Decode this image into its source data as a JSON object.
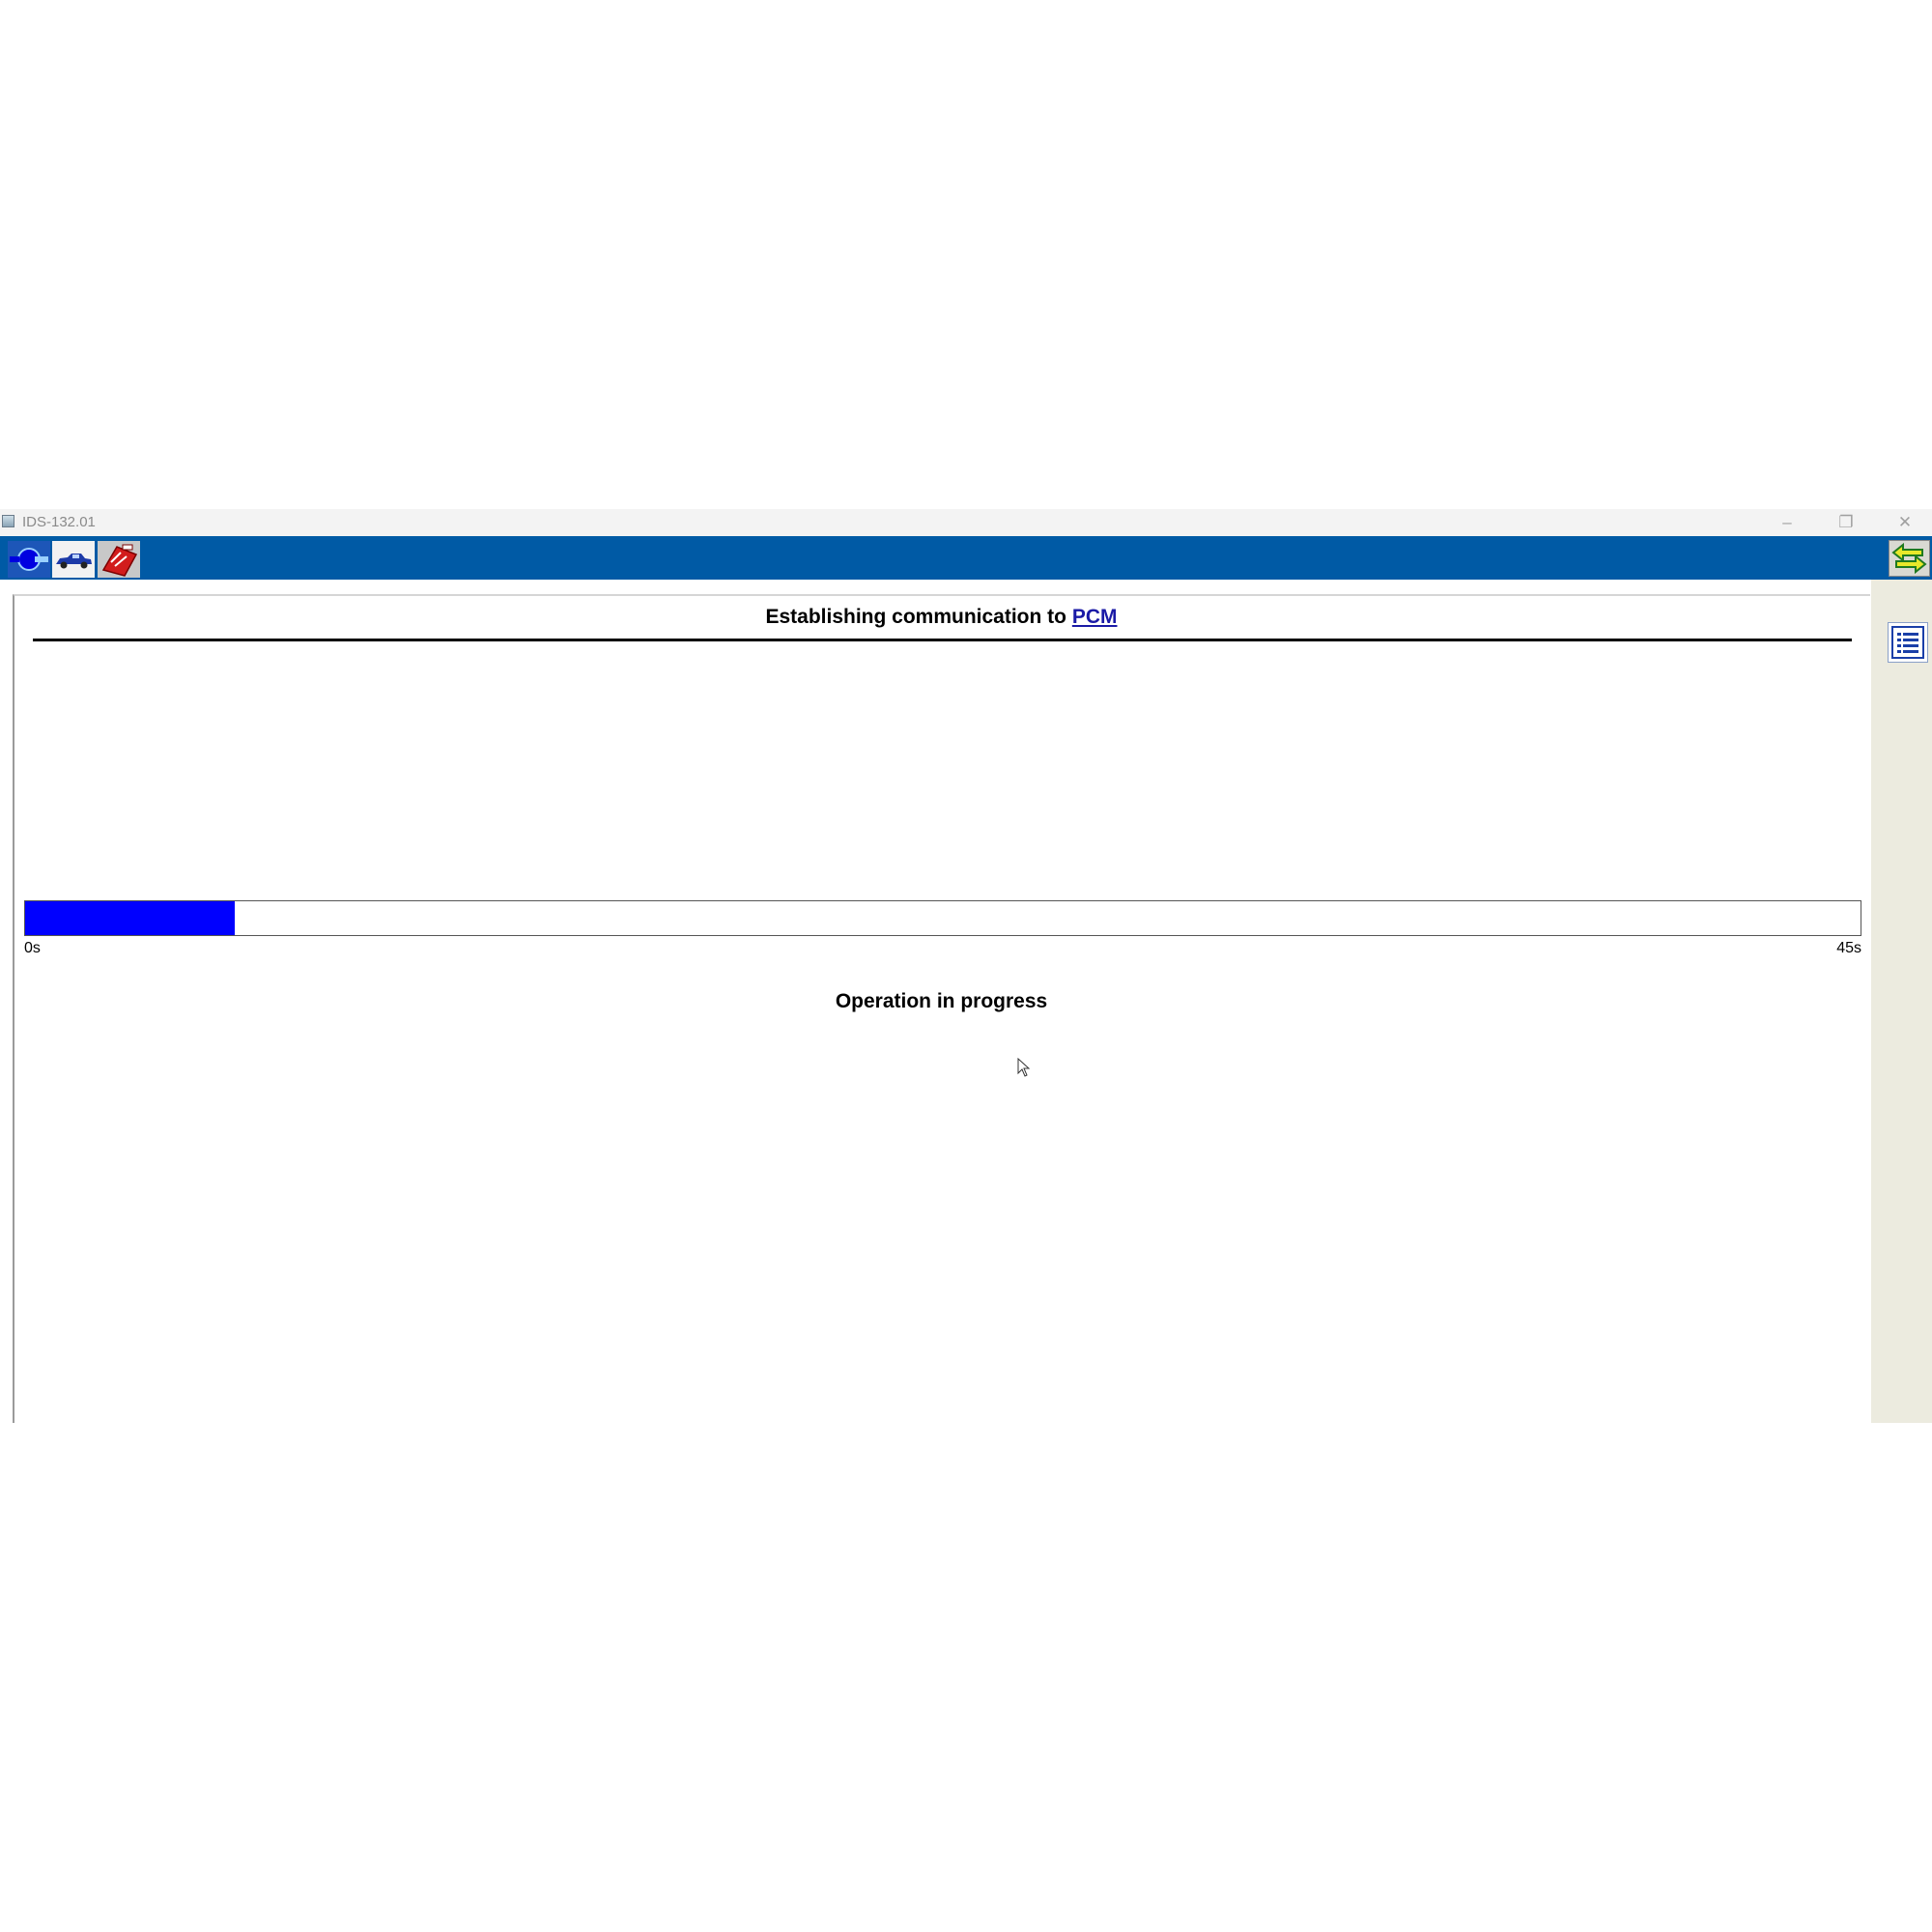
{
  "window": {
    "title": "IDS-132.01",
    "controls": {
      "minimize": "–",
      "restore": "❐",
      "close": "✕"
    }
  },
  "toolbar": {
    "buttons": [
      {
        "icon": "connector-icon"
      },
      {
        "icon": "vehicle-icon"
      },
      {
        "icon": "toolbox-icon"
      }
    ],
    "right_button": {
      "icon": "swap-arrows-icon"
    }
  },
  "sidebar": {
    "buttons": [
      {
        "icon": "list-icon"
      }
    ]
  },
  "main": {
    "heading_prefix": "Establishing communication to",
    "heading_link": "PCM",
    "progress": {
      "fraction": 0.114,
      "min_label": "0s",
      "max_label": "45s"
    },
    "status_text": "Operation in progress"
  },
  "colors": {
    "toolbar_bg": "#005aa5",
    "progress_fill": "#0000ff",
    "sidebar_bg": "#ecebdf",
    "link": "#1a1aa6"
  }
}
